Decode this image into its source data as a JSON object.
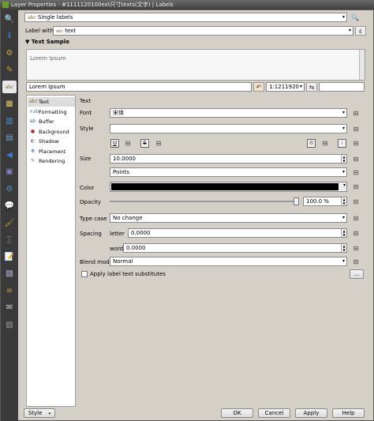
{
  "window": {
    "title": "Layer Properties - #1111120100ext尺寸texts(文字) | Labels"
  },
  "sidebar": {
    "items": [
      {
        "name": "search",
        "icon": "search-icon",
        "glyph": "🔍"
      },
      {
        "name": "information",
        "icon": "info-icon",
        "glyph": "ℹ"
      },
      {
        "name": "source",
        "icon": "settings-icon",
        "glyph": "⚙"
      },
      {
        "name": "symbology",
        "icon": "symbology-icon",
        "glyph": "✎"
      },
      {
        "name": "labels",
        "icon": "labels-icon",
        "glyph": "abc"
      },
      {
        "name": "diagrams",
        "icon": "diagram-icon",
        "glyph": "▦"
      },
      {
        "name": "fields",
        "icon": "fields-icon",
        "glyph": "▥"
      },
      {
        "name": "attributes-form",
        "icon": "form-icon",
        "glyph": "▤"
      },
      {
        "name": "joins",
        "icon": "joins-icon",
        "glyph": "◀"
      },
      {
        "name": "auxiliary-storage",
        "icon": "storage-icon",
        "glyph": "▣"
      },
      {
        "name": "actions",
        "icon": "actions-icon",
        "glyph": "⚙"
      },
      {
        "name": "display",
        "icon": "display-icon",
        "glyph": "💬"
      },
      {
        "name": "rendering",
        "icon": "rendering-icon",
        "glyph": "🖌"
      },
      {
        "name": "variables",
        "icon": "variables-icon",
        "glyph": "∑"
      },
      {
        "name": "metadata",
        "icon": "metadata-icon",
        "glyph": "📝"
      },
      {
        "name": "dependencies",
        "icon": "dependencies-icon",
        "glyph": "▧"
      },
      {
        "name": "legend",
        "icon": "legend-icon",
        "glyph": "≡"
      },
      {
        "name": "qgis-server",
        "icon": "server-icon",
        "glyph": "✉"
      },
      {
        "name": "digitizing",
        "icon": "digitizing-icon",
        "glyph": "▨"
      }
    ]
  },
  "labels_mode": {
    "value": "Single labels"
  },
  "label_with": {
    "label": "Label with",
    "value": "text"
  },
  "text_sample": {
    "header": "Text Sample",
    "preview_text": "Lorem Ipsum",
    "input_value": "Lorem Ipsum",
    "scale_value": "1:1211920"
  },
  "nav": {
    "items": [
      {
        "label": "Text",
        "icon": "abc"
      },
      {
        "label": "Formatting",
        "icon": "+ab"
      },
      {
        "label": "Buffer",
        "icon": "ab"
      },
      {
        "label": "Background",
        "icon": "●"
      },
      {
        "label": "Shadow",
        "icon": "◐"
      },
      {
        "label": "Placement",
        "icon": "✥"
      },
      {
        "label": "Rendering",
        "icon": "✎"
      }
    ]
  },
  "text_panel": {
    "section_title": "Text",
    "font_label": "Font",
    "font_value": "宋体",
    "style_label": "Style",
    "style_value": "",
    "underline": "U",
    "strikeout": "S",
    "bold": "B",
    "italic": "I",
    "size_label": "Size",
    "size_value": "10.0000",
    "size_unit": "Points",
    "color_label": "Color",
    "color_hex": "#000000",
    "opacity_label": "Opacity",
    "opacity_value": "100.0 %",
    "opacity_fraction": 1.0,
    "type_case_label": "Type case",
    "type_case_value": "No change",
    "spacing_label": "Spacing",
    "letter_label": "letter",
    "letter_value": "0.0000",
    "word_label": "word",
    "word_value": "0.0000",
    "blend_mode_label": "Blend mode",
    "blend_mode_value": "Normal",
    "substitutes_label": "Apply label text substitutes",
    "substitutes_button": "..."
  },
  "footer": {
    "style": "Style",
    "ok": "OK",
    "cancel": "Cancel",
    "apply": "Apply",
    "help": "Help"
  }
}
